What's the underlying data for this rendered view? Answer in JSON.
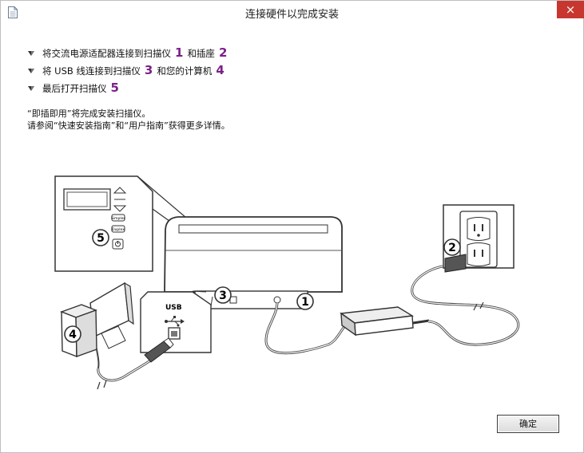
{
  "window": {
    "title": "连接硬件以完成安装",
    "close_glyph": "×"
  },
  "steps": [
    {
      "pre": "将交流电源适配器连接到扫描仪",
      "n1": "1",
      "mid": "和插座",
      "n2": "2"
    },
    {
      "pre": "将 USB 线连接到扫描仪",
      "n1": "3",
      "mid": "和您的计算机",
      "n2": "4"
    },
    {
      "pre": "最后打开扫描仪",
      "n1": "5"
    }
  ],
  "notes": {
    "line1": "“即插即用”将完成安装扫描仪。",
    "line2": "请参阅“快速安装指南”和“用户指南”获得更多详情。"
  },
  "illustration": {
    "usb_label": "USB",
    "callouts": [
      "1",
      "2",
      "3",
      "4",
      "5"
    ],
    "panel_buttons": [
      "Simplex",
      "Duplex"
    ]
  },
  "buttons": {
    "ok_label": "确定"
  },
  "colors": {
    "accent_purple": "#7b1f89",
    "close_red": "#c7372f"
  }
}
